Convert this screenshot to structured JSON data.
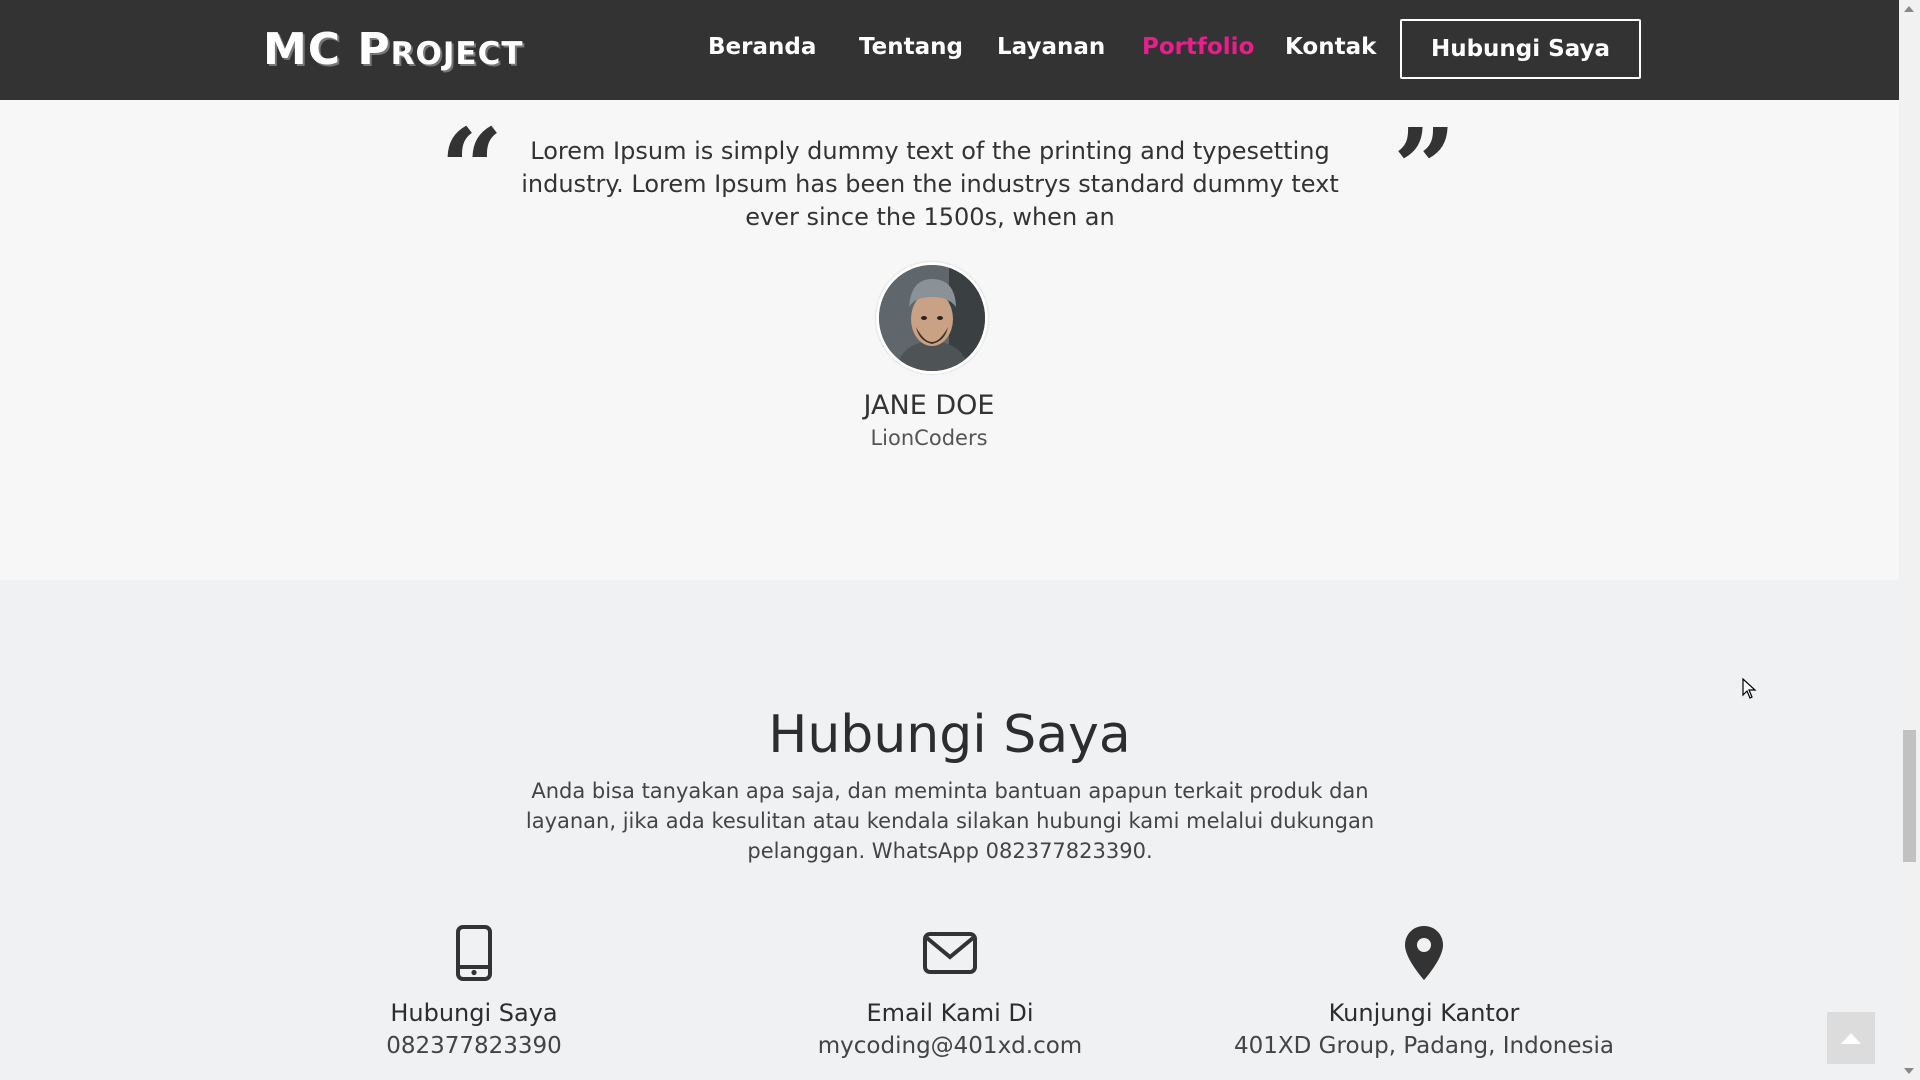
{
  "brand": {
    "logo_text": "MC Project"
  },
  "nav": {
    "items": [
      {
        "label": "Beranda"
      },
      {
        "label": "Tentang"
      },
      {
        "label": "Layanan"
      },
      {
        "label": "Portfolio",
        "active": true
      },
      {
        "label": "Kontak"
      }
    ],
    "cta_label": "Hubungi Saya",
    "accent_color": "#e91e8c"
  },
  "testimonial": {
    "quote": "Lorem Ipsum is simply dummy text of the printing and typesetting industry. Lorem Ipsum has been the industrys standard dummy text ever since the 1500s, when an",
    "open_quote": "“",
    "close_quote": "”",
    "name": "JANE DOE",
    "organization": "LionCoders",
    "avatar_icon": "person-avatar"
  },
  "contact": {
    "title": "Hubungi Saya",
    "description": "Anda bisa tanyakan apa saja, dan meminta bantuan apapun terkait produk dan layanan, jika ada kesulitan atau kendala silakan hubungi kami melalui dukungan pelanggan. WhatsApp 082377823390.",
    "items": [
      {
        "icon": "mobile-phone-icon",
        "title": "Hubungi Saya",
        "value": "082377823390"
      },
      {
        "icon": "envelope-icon",
        "title": "Email Kami Di",
        "value": "mycoding@401xd.com"
      },
      {
        "icon": "map-pin-icon",
        "title": "Kunjungi Kantor",
        "value": "401XD Group, Padang, Indonesia"
      }
    ]
  }
}
